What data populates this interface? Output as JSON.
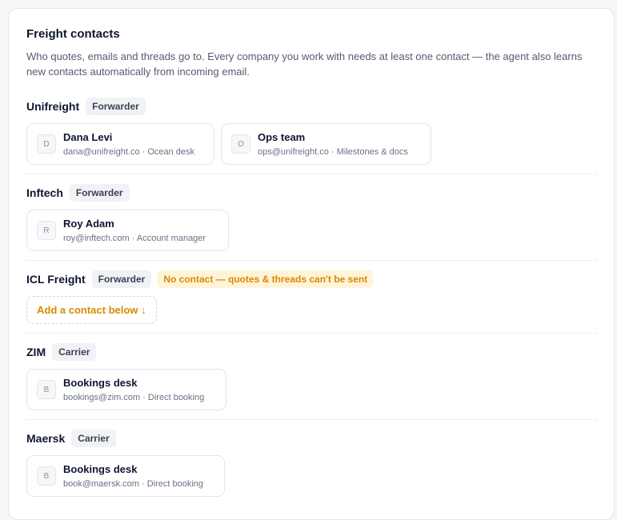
{
  "header": {
    "title": "Freight contacts",
    "description": "Who quotes, emails and threads go to. Every company you work with needs at least one contact — the agent also learns new contacts automatically from incoming email."
  },
  "companies": [
    {
      "name": "Unifreight",
      "type": "Forwarder",
      "contacts": [
        {
          "initial": "D",
          "name": "Dana Levi",
          "detail": "dana@unifreight.co · Ocean desk"
        },
        {
          "initial": "O",
          "name": "Ops team",
          "detail": "ops@unifreight.co · Milestones & docs"
        }
      ]
    },
    {
      "name": "Inftech",
      "type": "Forwarder",
      "contacts": [
        {
          "initial": "R",
          "name": "Roy Adam",
          "detail": "roy@inftech.com · Account manager"
        }
      ]
    },
    {
      "name": "ICL Freight",
      "type": "Forwarder",
      "warning": "No contact — quotes & threads can't be sent",
      "add_label": "Add a contact below",
      "add_arrow": "↓"
    },
    {
      "name": "ZIM",
      "type": "Carrier",
      "contacts": [
        {
          "initial": "B",
          "name": "Bookings desk",
          "detail": "bookings@zim.com · Direct booking"
        }
      ]
    },
    {
      "name": "Maersk",
      "type": "Carrier",
      "contacts": [
        {
          "initial": "B",
          "name": "Bookings desk",
          "detail": "book@maersk.com · Direct booking"
        }
      ]
    }
  ],
  "colors": {
    "warning_text": "#d98a00",
    "warning_bg": "#fff4d9"
  }
}
